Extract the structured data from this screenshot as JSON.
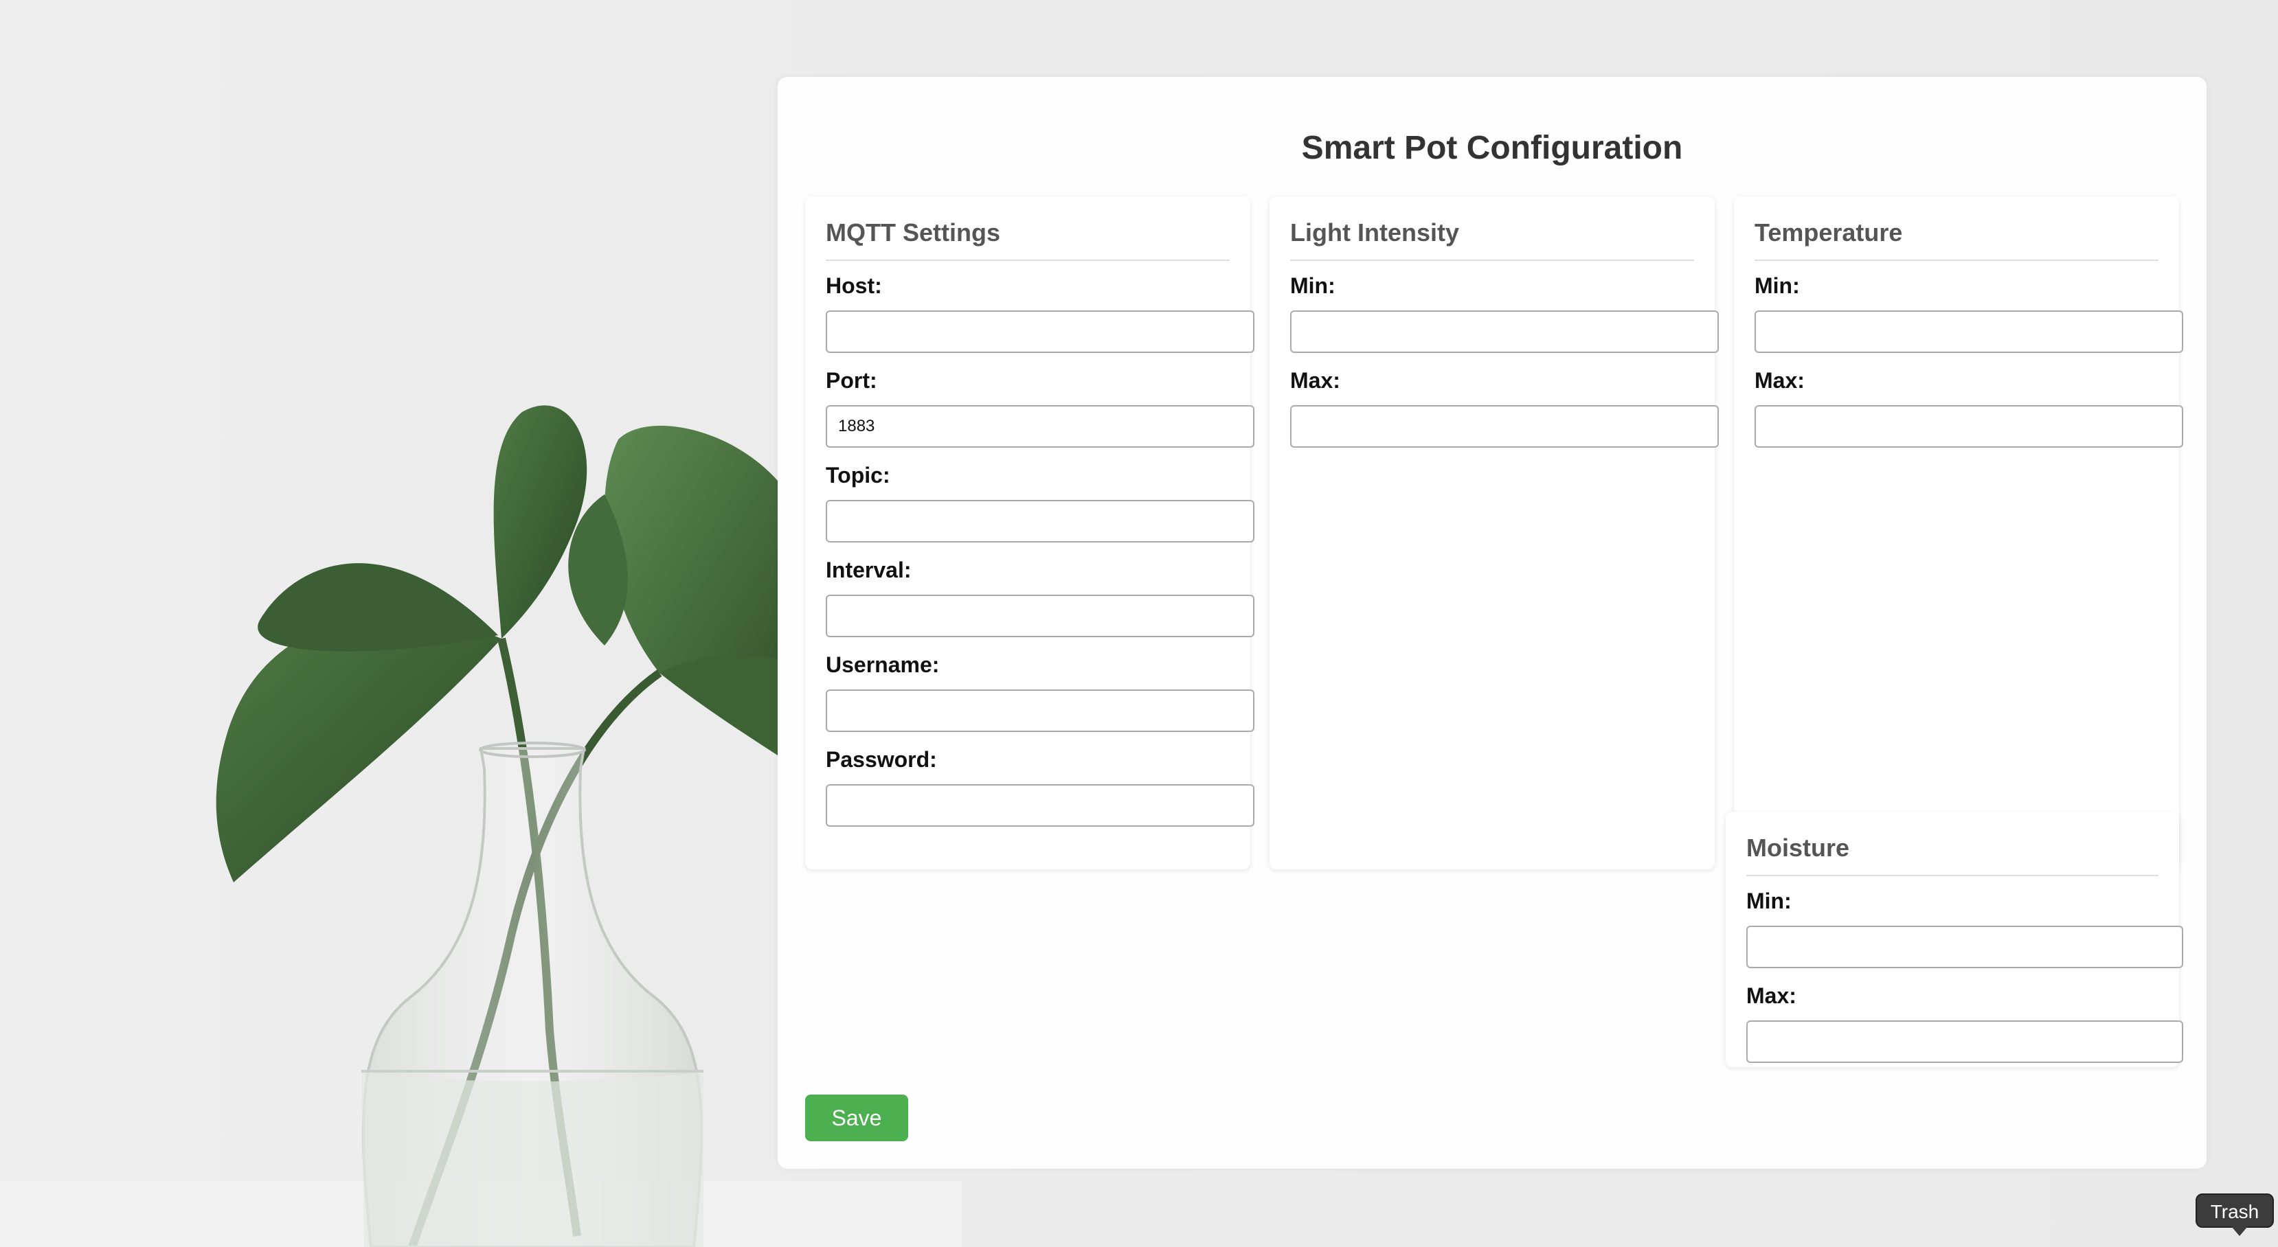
{
  "page": {
    "title": "Smart Pot Configuration",
    "accent_color": "#4caf50"
  },
  "mqtt": {
    "title": "MQTT Settings",
    "host_label": "Host:",
    "host_value": "",
    "port_label": "Port:",
    "port_value": "1883",
    "topic_label": "Topic:",
    "topic_value": "",
    "interval_label": "Interval:",
    "interval_value": "",
    "username_label": "Username:",
    "username_value": "",
    "password_label": "Password:",
    "password_value": ""
  },
  "light": {
    "title": "Light Intensity",
    "min_label": "Min:",
    "min_value": "",
    "max_label": "Max:",
    "max_value": ""
  },
  "temperature": {
    "title": "Temperature",
    "min_label": "Min:",
    "min_value": "",
    "max_label": "Max:",
    "max_value": ""
  },
  "moisture": {
    "title": "Moisture",
    "min_label": "Min:",
    "min_value": "",
    "max_label": "Max:",
    "max_value": ""
  },
  "actions": {
    "save_label": "Save"
  },
  "dock": {
    "tooltip": "Trash"
  }
}
